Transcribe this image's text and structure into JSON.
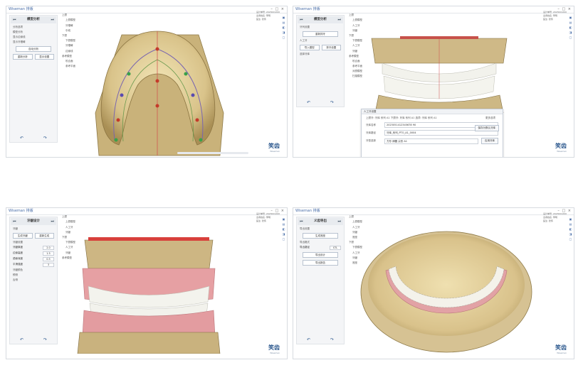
{
  "panes": [
    {
      "app": "Wiseman 排版",
      "step_title": "模型分析",
      "prev_icon": "⏮",
      "next_icon": "⏭",
      "labels": [
        "分析选项",
        "模型分析",
        "显示边缘线",
        "显示牙槽嵴",
        "中线",
        "显示设置"
      ],
      "buttons": [
        "自动分析",
        "重新分析",
        "上一步",
        "下一步"
      ],
      "tree": [
        "上颌",
        "上颌模型",
        "牙槽嵴",
        "中线",
        "下颌",
        "下颌模型",
        "牙槽嵴",
        "边缘线",
        "参考模型",
        "咬合面",
        "参考平面"
      ],
      "info": [
        "设计单号: 2023001200",
        "患者姓名: 李明",
        "医生: 张伟"
      ]
    },
    {
      "app": "Wiseman 排版",
      "step_title": "模型分析",
      "prev_icon": "⏮",
      "next_icon": "⏭",
      "labels": [
        "牙列设置",
        "人工牙",
        "选择牙库"
      ],
      "buttons": [
        "重新排牙",
        "导入模型",
        "排牙设置"
      ],
      "tree": [
        "上颌",
        "上颌模型",
        "人工牙",
        "牙龈",
        "下颌",
        "下颌模型",
        "人工牙",
        "牙龈",
        "参考模型",
        "咬合面",
        "参考平面",
        "对颌模型",
        "扫描模型"
      ],
      "info": [
        "设计单号: 2023001200",
        "患者姓名: 李明",
        "医生: 张伟"
      ],
      "dialog": {
        "header": "人工牙设置",
        "top": "上颌牙: 牙库 系列 A1  下颌牙: 牙库 系列 A1  选项: 牙库 系列 A1",
        "side_label": "更多选项",
        "side_btn": "保存为默认牙库",
        "rows": [
          {
            "k": "牙库名称",
            "v": "2023051412345678 90"
          },
          {
            "k": "牙库路径",
            "v": "牙库_系列_PTO_A1_0004"
          },
          {
            "k": "牙型选择",
            "v": "方形   卵圆   尖形   A1"
          }
        ],
        "apply": "应用牙库"
      }
    },
    {
      "app": "Wiseman 排版",
      "step_title": "牙龈设计",
      "prev_icon": "⏮",
      "next_icon": "⏭",
      "labels": [
        "牙龈",
        "牙龈设置",
        "牙龈厚度",
        "边缘高度",
        "牙龈颜色",
        "颊侧",
        "舌侧",
        "平滑",
        "显示"
      ],
      "buttons": [
        "生成牙龈",
        "重新生成",
        "上一步",
        "下一步"
      ],
      "fields": [
        [
          "牙龈厚度",
          "2.0"
        ],
        [
          "边缘高度",
          "1.5"
        ],
        [
          "颈缘深度",
          "0.5"
        ],
        [
          "平滑强度",
          "3"
        ]
      ],
      "tree": [
        "上颌",
        "上颌模型",
        "人工牙",
        "牙龈",
        "下颌",
        "下颌模型",
        "人工牙",
        "牙龈",
        "参考模型"
      ],
      "info": [
        "设计单号: 2023001200",
        "患者姓名: 李明",
        "医生: 张伟"
      ]
    },
    {
      "app": "Wiseman 排版",
      "step_title": "义齿导出",
      "prev_icon": "⏮",
      "next_icon": "⏭",
      "labels": [
        "导出设置",
        "导出格式",
        "导出路径",
        "STL"
      ],
      "buttons": [
        "生成底座",
        "导出设计",
        "导出报告"
      ],
      "tree": [
        "上颌",
        "上颌模型",
        "人工牙",
        "牙龈",
        "底座",
        "下颌",
        "下颌模型",
        "人工牙",
        "牙龈",
        "底座"
      ],
      "info": [
        "设计单号: 2023001200",
        "患者姓名: 李明",
        "医生: 张伟"
      ]
    }
  ],
  "brand": {
    "name": "笑齿",
    "sub": "Wiseman"
  }
}
